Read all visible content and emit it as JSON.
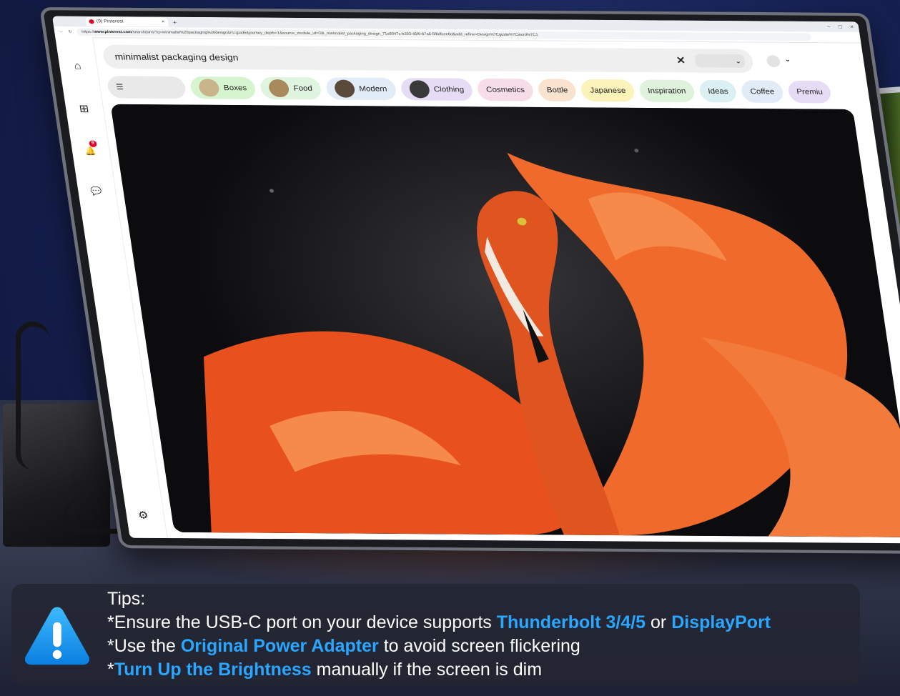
{
  "browser": {
    "tab_title": "(9) Pinterest",
    "tab_close": "×",
    "new_tab": "+",
    "window_controls": [
      "–",
      "□",
      "×"
    ],
    "url_prefix": "https://",
    "url_domain": "www.pinterest.com",
    "url_rest": "/search/pins/?q=minimalist%20packaging%20design&rs=guide&journey_depth=1&source_module_id=OB_minimalist_packaging_design_71e8047c-b393-45f0-b7a6-5f8dfcee8d&add_refine=Design%7Cguide%7Cword%7C1"
  },
  "sidebar": {
    "home_icon": "⌂",
    "create_icon": "⊞",
    "notifications_icon": "🔔",
    "notifications_badge": "9",
    "messages_icon": "💬",
    "settings_icon": "⚙"
  },
  "search": {
    "query": "minimalist packaging design",
    "clear_icon": "✕",
    "dropdown_chevron": "⌄"
  },
  "profile": {
    "chevron": "⌄"
  },
  "chips": [
    {
      "label": "",
      "icon": "sliders-icon",
      "color": "#e9e9e9"
    },
    {
      "label": "Boxes",
      "color": "#d6f5cf",
      "thumb": "#c9b38a"
    },
    {
      "label": "Food",
      "color": "#dff5e0",
      "thumb": "#a98a5c"
    },
    {
      "label": "Modern",
      "color": "#e2ecf7",
      "thumb": "#5b4a3a"
    },
    {
      "label": "Clothing",
      "color": "#e6dcf6",
      "thumb": "#3a3a3a"
    },
    {
      "label": "Cosmetics",
      "color": "#f7dde8"
    },
    {
      "label": "Bottle",
      "color": "#f9e3cf"
    },
    {
      "label": "Japanese",
      "color": "#fbf3b9"
    },
    {
      "label": "Inspiration",
      "color": "#dff3dc"
    },
    {
      "label": "Ideas",
      "color": "#daf0f2"
    },
    {
      "label": "Coffee",
      "color": "#e2ebf8"
    },
    {
      "label": "Premiu",
      "color": "#e6dcf6"
    }
  ],
  "tips": {
    "heading": "Tips:",
    "line1_a": "*Ensure the USB-C port on your device supports ",
    "line1_hl1": "Thunderbolt 3/4/5",
    "line1_b": " or ",
    "line1_hl2": "DisplayPort",
    "line2_a": "*Use the ",
    "line2_hl": "Original Power Adapter",
    "line2_b": " to avoid screen flickering",
    "line3_a": "*",
    "line3_hl": "Turn Up the Brightness",
    "line3_b": " manually if the screen is dim",
    "highlight_color": "#2ba6ff"
  }
}
